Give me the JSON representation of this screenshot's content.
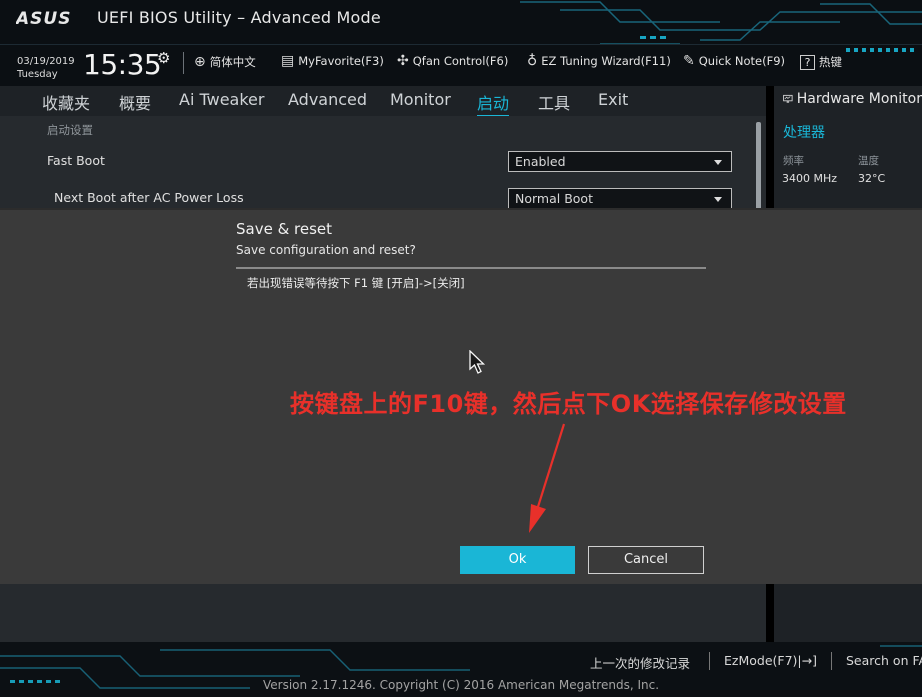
{
  "header": {
    "logo_text": "ASUS",
    "title": "UEFI BIOS Utility – Advanced Mode",
    "date": "03/19/2019",
    "day": "Tuesday",
    "time": "15:35",
    "tools": [
      {
        "label": "简体中文",
        "icon": "globe-icon"
      },
      {
        "label": "MyFavorite(F3)",
        "icon": "favorite-icon"
      },
      {
        "label": "Qfan Control(F6)",
        "icon": "fan-icon"
      },
      {
        "label": "EZ Tuning Wizard(F11)",
        "icon": "bulb-icon"
      },
      {
        "label": "Quick Note(F9)",
        "icon": "note-icon"
      },
      {
        "label": "热键",
        "icon": "help-icon"
      }
    ]
  },
  "menu": {
    "items": [
      "收藏夹",
      "概要",
      "Ai Tweaker",
      "Advanced",
      "Monitor",
      "启动",
      "工具",
      "Exit"
    ],
    "active": "启动"
  },
  "main": {
    "section_title": "启动设置",
    "settings": [
      {
        "label": "Fast Boot",
        "value": "Enabled"
      },
      {
        "label": "Next Boot after AC Power Loss",
        "value": "Normal Boot"
      }
    ]
  },
  "hardware_monitor": {
    "title": "Hardware Monitor",
    "section": "处理器",
    "freq_label": "频率",
    "freq_value": "3400 MHz",
    "temp_label": "温度",
    "temp_value": "32°C"
  },
  "dialog": {
    "title": "Save & reset",
    "subtitle": "Save configuration and reset?",
    "message": "若出现错误等待按下 F1 键 [开启]->[关闭]",
    "ok_label": "Ok",
    "cancel_label": "Cancel"
  },
  "annotation": {
    "text": "按键盘上的F10键，然后点下OK选择保存修改设置",
    "color": "#e8302a"
  },
  "footer": {
    "links": [
      "上一次的修改记录",
      "EzMode(F7)|→]",
      "Search on FAQ"
    ],
    "version": "Version 2.17.1246. Copyright (C) 2016 American Megatrends, Inc."
  },
  "colors": {
    "accent": "#1ab6d6",
    "background": "#262a2e",
    "dialog": "#3a3a3a"
  }
}
